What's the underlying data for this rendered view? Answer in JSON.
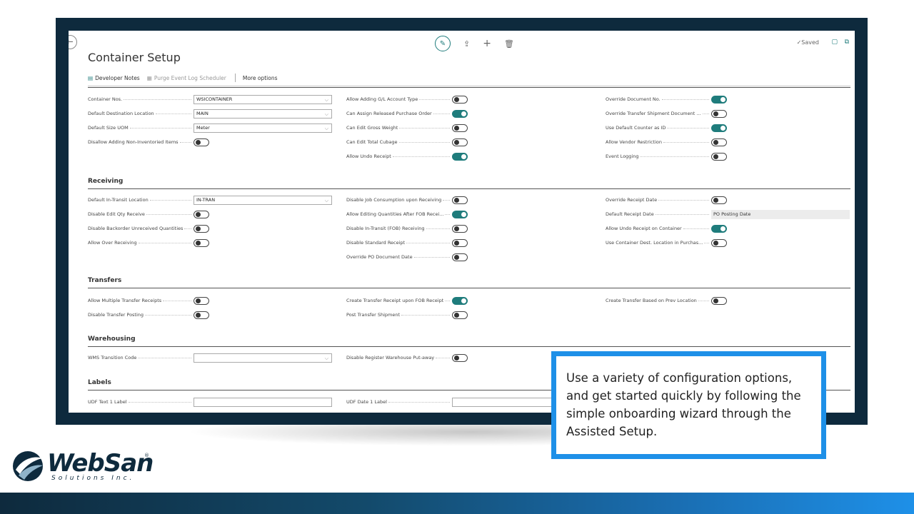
{
  "page": {
    "title": "Container Setup",
    "saved_label": "Saved"
  },
  "actions": {
    "developer_notes": "Developer Notes",
    "purge_scheduler": "Purge Event Log Scheduler",
    "more_options": "More options"
  },
  "general": {
    "col1": [
      {
        "label": "Container Nos.",
        "type": "select",
        "value": "WSICONTAINER"
      },
      {
        "label": "Default Destination Location",
        "type": "select",
        "value": "MAIN"
      },
      {
        "label": "Default Size UOM",
        "type": "select",
        "value": "Meter"
      },
      {
        "label": "Disallow Adding Non-Inventoried Items",
        "type": "toggle",
        "on": false
      }
    ],
    "col2": [
      {
        "label": "Allow Adding G/L Account Type",
        "type": "toggle",
        "on": false
      },
      {
        "label": "Can Assign Released Purchase Order",
        "type": "toggle",
        "on": true
      },
      {
        "label": "Can Edit Gross Weight",
        "type": "toggle",
        "on": false
      },
      {
        "label": "Can Edit Total Cubage",
        "type": "toggle",
        "on": false
      },
      {
        "label": "Allow Undo Receipt",
        "type": "toggle",
        "on": true
      }
    ],
    "col3": [
      {
        "label": "Override Document No.",
        "type": "toggle",
        "on": true
      },
      {
        "label": "Override Transfer Shipment Document ...",
        "type": "toggle",
        "on": false
      },
      {
        "label": "Use Default Counter as ID",
        "type": "toggle",
        "on": true
      },
      {
        "label": "Allow Vendor Restriction",
        "type": "toggle",
        "on": false
      },
      {
        "label": "Event Logging",
        "type": "toggle",
        "on": false
      }
    ]
  },
  "receiving": {
    "title": "Receiving",
    "col1": [
      {
        "label": "Default In-Transit Location",
        "type": "select",
        "value": "IN-TRAN"
      },
      {
        "label": "Disable Edit Qty Receive",
        "type": "toggle",
        "on": false
      },
      {
        "label": "Disable Backorder Unreceived Quantities",
        "type": "toggle",
        "on": false
      },
      {
        "label": "Allow Over Receiving",
        "type": "toggle",
        "on": false
      }
    ],
    "col2": [
      {
        "label": "Disable Job Consumption upon Receiving",
        "type": "toggle",
        "on": false
      },
      {
        "label": "Allow Editing Quantities After FOB Recei...",
        "type": "toggle",
        "on": true
      },
      {
        "label": "Disable In-Transit (FOB) Receiving",
        "type": "toggle",
        "on": false
      },
      {
        "label": "Disable Standard Receipt",
        "type": "toggle",
        "on": false
      },
      {
        "label": "Override PO Document Date",
        "type": "toggle",
        "on": false
      }
    ],
    "col3": [
      {
        "label": "Override Receipt Date",
        "type": "toggle",
        "on": false
      },
      {
        "label": "Default Receipt Date",
        "type": "value",
        "value": "PO Posting Date"
      },
      {
        "label": "Allow Undo Receipt on Container",
        "type": "toggle",
        "on": true
      },
      {
        "label": "Use Container Dest. Location in Purchas...",
        "type": "toggle",
        "on": false
      }
    ]
  },
  "transfers": {
    "title": "Transfers",
    "col1": [
      {
        "label": "Allow Multiple Transfer Receipts",
        "type": "toggle",
        "on": false
      },
      {
        "label": "Disable Transfer Posting",
        "type": "toggle",
        "on": false
      }
    ],
    "col2": [
      {
        "label": "Create Transfer Receipt upon FOB Receipt",
        "type": "toggle",
        "on": true
      },
      {
        "label": "Post Transfer Shipment",
        "type": "toggle",
        "on": false
      }
    ],
    "col3": [
      {
        "label": "Create Transfer Based on Prev Location",
        "type": "toggle",
        "on": false
      }
    ]
  },
  "warehousing": {
    "title": "Warehousing",
    "col1": [
      {
        "label": "WMS Transition Code",
        "type": "select",
        "value": ""
      }
    ],
    "col2": [
      {
        "label": "Disable Register Warehouse Put-away",
        "type": "toggle",
        "on": false
      }
    ],
    "col3": []
  },
  "labels": {
    "title": "Labels",
    "col1": [
      {
        "label": "UDF Text 1 Label",
        "type": "text",
        "value": ""
      }
    ],
    "col2": [
      {
        "label": "UDF Date 1 Label",
        "type": "text",
        "value": ""
      }
    ],
    "col3": []
  },
  "callout": {
    "text": " Use a variety of configuration options, and get started quickly by following the simple onboarding wizard through the Assisted Setup."
  },
  "logo": {
    "name": "WebSan",
    "sub": "Solutions Inc.",
    "reg": "®"
  },
  "colors": {
    "accent": "#1f7c7c",
    "callout_border": "#1e90e8",
    "frame": "#0e2a3d"
  },
  "icons": [
    "back-arrow-icon",
    "edit-icon",
    "share-icon",
    "add-icon",
    "delete-icon",
    "checkmark-icon",
    "bookmark-icon",
    "open-new-icon",
    "notes-icon",
    "scheduler-icon"
  ]
}
